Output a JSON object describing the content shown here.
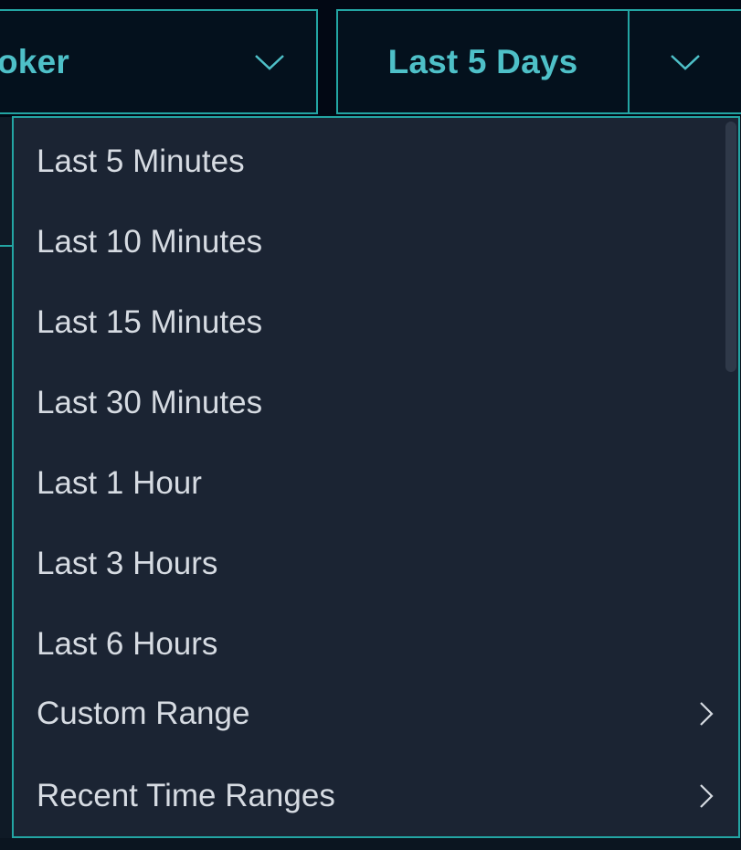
{
  "toolbar": {
    "source_select": {
      "value": "oker",
      "chevron_icon": "chevron-down-icon"
    },
    "time_range_select": {
      "value": "Last 5 Days",
      "chevron_icon": "chevron-down-icon"
    }
  },
  "dropdown": {
    "items": [
      {
        "label": "Last 5 Minutes",
        "has_submenu": false
      },
      {
        "label": "Last 10 Minutes",
        "has_submenu": false
      },
      {
        "label": "Last 15 Minutes",
        "has_submenu": false
      },
      {
        "label": "Last 30 Minutes",
        "has_submenu": false
      },
      {
        "label": "Last 1 Hour",
        "has_submenu": false
      },
      {
        "label": "Last 3 Hours",
        "has_submenu": false
      },
      {
        "label": "Last 6 Hours",
        "has_submenu": false
      },
      {
        "label": "Custom Range",
        "has_submenu": true,
        "icon": "chevron-right-icon"
      },
      {
        "label": "Recent Time Ranges",
        "has_submenu": true,
        "icon": "chevron-right-icon"
      }
    ]
  },
  "colors": {
    "accent": "#23a5a3",
    "accent_text": "#4ec0c8",
    "menu_bg": "#1b2433",
    "menu_text": "#d6dbe2",
    "topbar_bg": "#020814"
  }
}
